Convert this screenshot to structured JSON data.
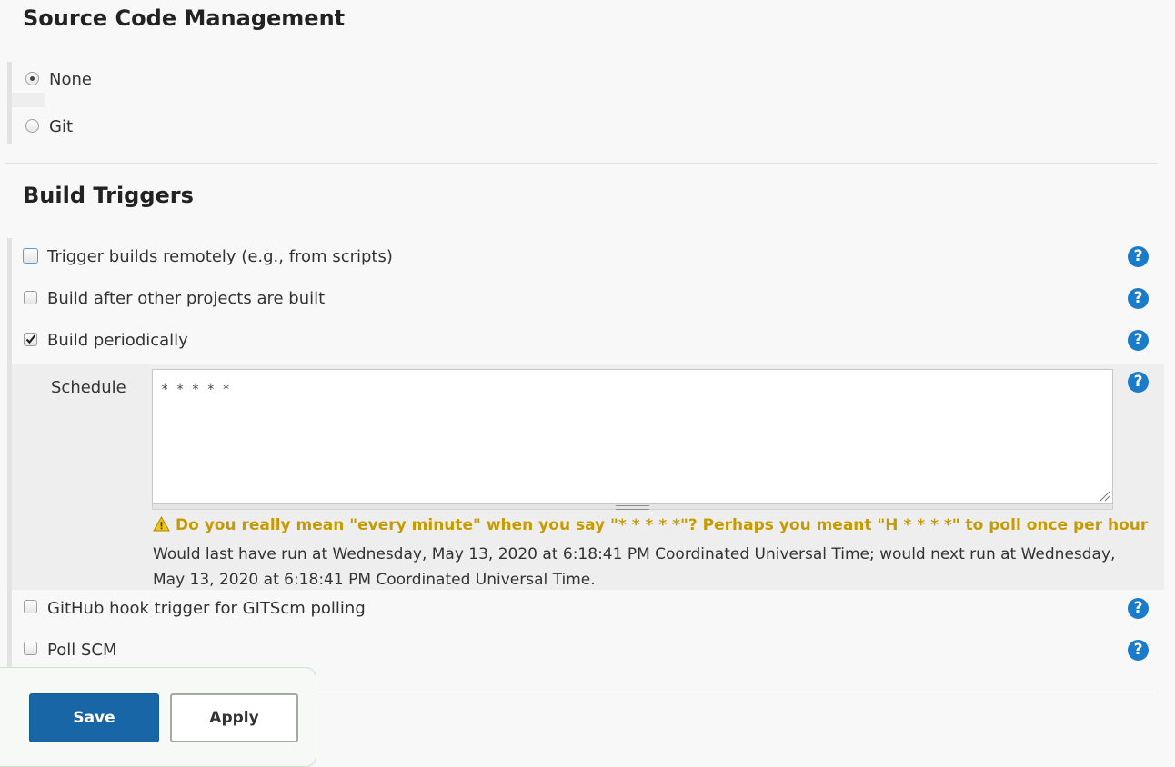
{
  "scm": {
    "title": "Source Code Management",
    "options": [
      {
        "label": "None",
        "selected": true
      },
      {
        "label": "Git",
        "selected": false
      }
    ]
  },
  "triggers": {
    "title": "Build Triggers",
    "items": [
      {
        "label": "Trigger builds remotely (e.g., from scripts)",
        "checked": false
      },
      {
        "label": "Build after other projects are built",
        "checked": false
      },
      {
        "label": "Build periodically",
        "checked": true
      },
      {
        "label": "GitHub hook trigger for GITScm polling",
        "checked": false
      },
      {
        "label": "Poll SCM",
        "checked": false
      }
    ],
    "schedule": {
      "label": "Schedule",
      "value": "* * * * *",
      "warning": "Do you really mean \"every minute\" when you say \"* * * * *\"? Perhaps you meant \"H * * * *\" to poll once per hour",
      "info": "Would last have run at Wednesday, May 13, 2020 at 6:18:41 PM Coordinated Universal Time; would next run at Wednesday, May 13, 2020 at 6:18:41 PM Coordinated Universal Time."
    },
    "help_glyph": "?"
  },
  "actions": {
    "save_label": "Save",
    "apply_label": "Apply"
  },
  "colors": {
    "accent": "#1a7bc9",
    "warning": "#c79b00",
    "save_bg": "#1866a6"
  },
  "icons": [
    "help-icon",
    "warning-icon",
    "checkmark-icon"
  ]
}
